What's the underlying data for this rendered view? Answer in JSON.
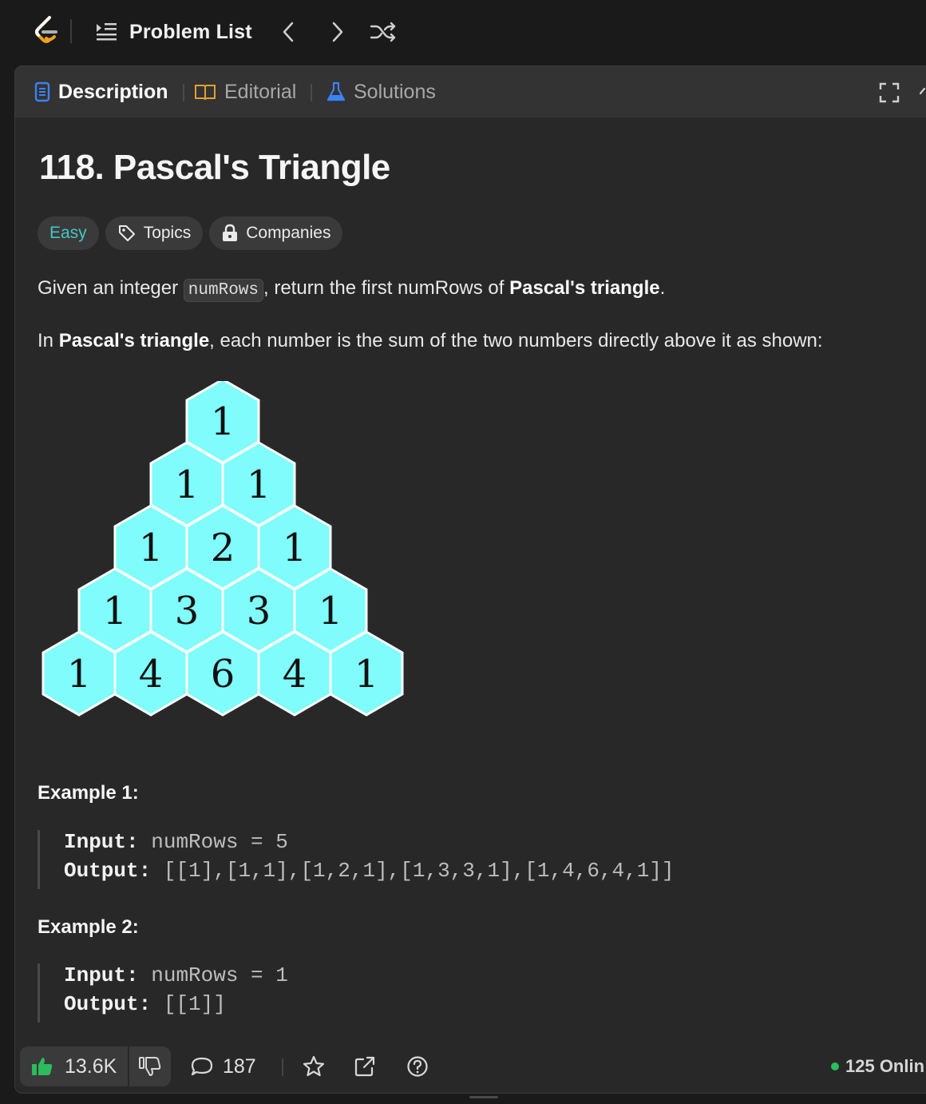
{
  "nav": {
    "problem_list_label": "Problem List"
  },
  "tabs": [
    {
      "label": "Description",
      "icon": "description-icon"
    },
    {
      "label": "Editorial",
      "icon": "book-icon"
    },
    {
      "label": "Solutions",
      "icon": "flask-icon"
    }
  ],
  "problem": {
    "title": "118. Pascal's Triangle",
    "difficulty": "Easy",
    "topics_label": "Topics",
    "companies_label": "Companies",
    "p1": {
      "pre": "Given an integer ",
      "code": "numRows",
      "mid": ", return the first numRows of ",
      "bold": "Pascal's triangle",
      "post": "."
    },
    "p2": {
      "pre": "In ",
      "bold": "Pascal's triangle",
      "post": ", each number is the sum of the two numbers directly above it as shown:"
    },
    "triangle_rows": [
      [
        "1"
      ],
      [
        "1",
        "1"
      ],
      [
        "1",
        "2",
        "1"
      ],
      [
        "1",
        "3",
        "3",
        "1"
      ],
      [
        "1",
        "4",
        "6",
        "4",
        "1"
      ]
    ],
    "examples": [
      {
        "heading": "Example 1:",
        "input_key": "Input:",
        "input_val": "numRows = 5",
        "output_key": "Output:",
        "output_val": "[[1],[1,1],[1,2,1],[1,3,3,1],[1,4,6,4,1]]"
      },
      {
        "heading": "Example 2:",
        "input_key": "Input:",
        "input_val": "numRows = 1",
        "output_key": "Output:",
        "output_val": "[[1]]"
      }
    ]
  },
  "footer": {
    "likes": "13.6K",
    "comments": "187",
    "online": "125 Onlin"
  },
  "colors": {
    "background": "#1a1a1a",
    "panel": "#282828",
    "easy": "#46c6c2",
    "hex_fill": "#7ffcfb",
    "like_green": "#2cbb5d",
    "online_dot": "#2cbb5d"
  }
}
